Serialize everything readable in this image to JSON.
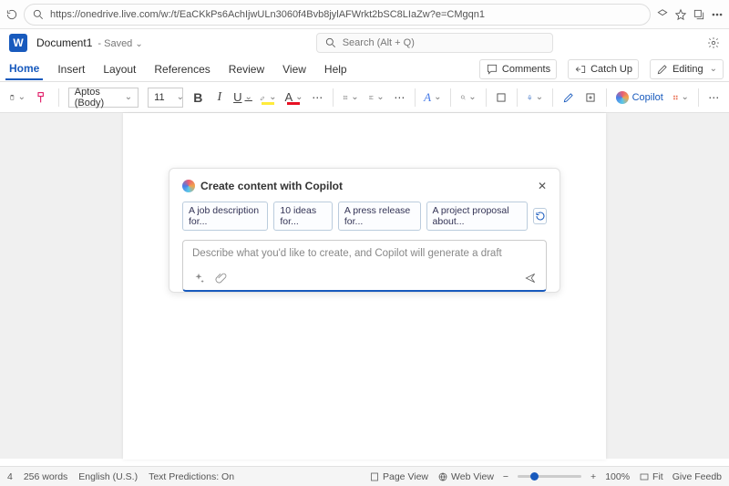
{
  "browser": {
    "url": "https://onedrive.live.com/w:/t/EaCKkPs6AchIjwULn3060f4Bvb8jylAFWrkt2bSC8LIaZw?e=CMgqn1"
  },
  "header": {
    "doc_title": "Document1",
    "saved_state": "Saved",
    "search_placeholder": "Search (Alt + Q)"
  },
  "tabs": [
    "Home",
    "Insert",
    "Layout",
    "References",
    "Review",
    "View",
    "Help"
  ],
  "right_tabs": {
    "comments": "Comments",
    "catch_up": "Catch Up",
    "editing": "Editing"
  },
  "ribbon": {
    "font_name": "Aptos (Body)",
    "font_size": "11",
    "copilot_label": "Copilot"
  },
  "copilot": {
    "title": "Create content with Copilot",
    "chips": [
      "A job description for...",
      "10 ideas for...",
      "A press release for...",
      "A project proposal about..."
    ],
    "placeholder": "Describe what you'd like to create, and Copilot will generate a draft"
  },
  "status": {
    "page": "4",
    "words": "256 words",
    "lang": "English (U.S.)",
    "predictions": "Text Predictions: On",
    "page_view": "Page View",
    "web_view": "Web View",
    "zoom": "100%",
    "fit": "Fit",
    "feedback": "Give Feedb"
  }
}
